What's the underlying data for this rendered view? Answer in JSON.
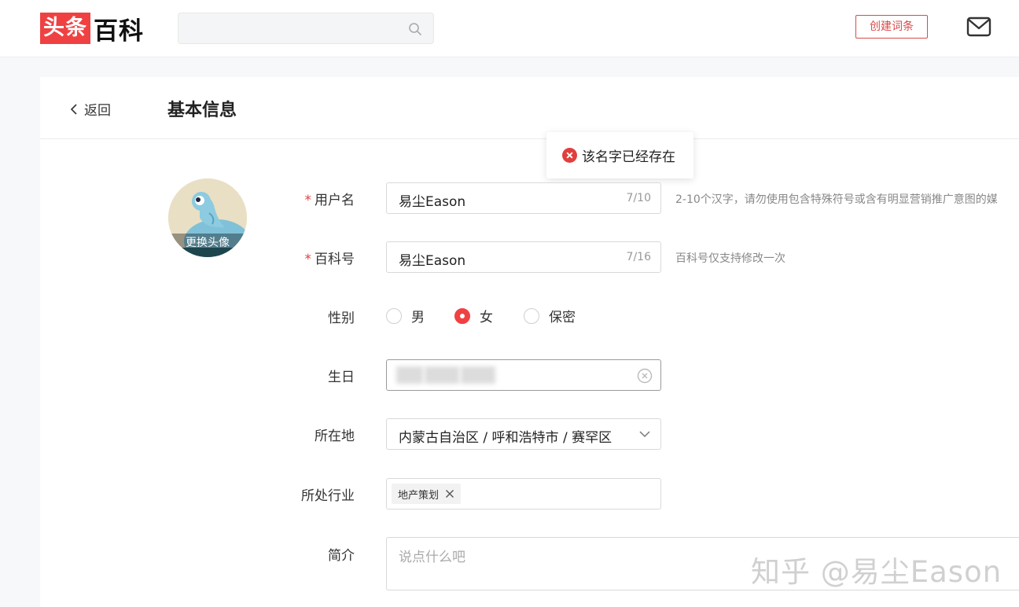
{
  "header": {
    "logo_red": "头条",
    "logo_black": "百科",
    "search_placeholder": "",
    "create_button": "创建词条"
  },
  "page": {
    "back_label": "返回",
    "title": "基本信息"
  },
  "toast": {
    "message": "该名字已经存在"
  },
  "avatar": {
    "change_label": "更换头像"
  },
  "form": {
    "username": {
      "label": "用户名",
      "value": "易尘Eason",
      "count": "7/10",
      "hint": "2-10个汉字，请勿使用包含特殊符号或含有明显营销推广意图的媒"
    },
    "baike_id": {
      "label": "百科号",
      "value": "易尘Eason",
      "count": "7/16",
      "hint": "百科号仅支持修改一次"
    },
    "gender": {
      "label": "性别",
      "options": [
        "男",
        "女",
        "保密"
      ],
      "selected": "女"
    },
    "birthday": {
      "label": "生日"
    },
    "location": {
      "label": "所在地",
      "value": "内蒙古自治区 / 呼和浩特市 / 赛罕区"
    },
    "industry": {
      "label": "所处行业",
      "tag": "地产策划"
    },
    "intro": {
      "label": "简介",
      "placeholder": "说点什么吧"
    }
  },
  "watermark": "知乎 @易尘Eason",
  "colors": {
    "brand_red": "#f04142",
    "error_red": "#e0403d"
  }
}
